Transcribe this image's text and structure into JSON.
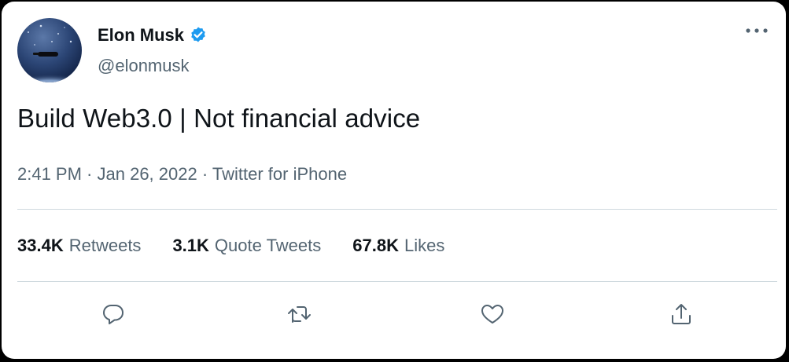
{
  "author": {
    "name": "Elon Musk",
    "handle": "@elonmusk",
    "verified": true,
    "verified_icon": "verified-badge-icon",
    "avatar_icon": "avatar-image"
  },
  "tweet": {
    "text": "Build Web3.0 | Not financial advice"
  },
  "meta": {
    "time": "2:41 PM",
    "separator1": " · ",
    "date": "Jan 26, 2022",
    "separator2": " · ",
    "source": "Twitter for iPhone"
  },
  "stats": [
    {
      "count": "33.4K",
      "label": "Retweets"
    },
    {
      "count": "3.1K",
      "label": "Quote Tweets"
    },
    {
      "count": "67.8K",
      "label": "Likes"
    }
  ],
  "actions": [
    {
      "icon": "reply-icon"
    },
    {
      "icon": "retweet-icon"
    },
    {
      "icon": "like-icon"
    },
    {
      "icon": "share-icon"
    }
  ],
  "more_icon": "more-options-icon",
  "colors": {
    "text_primary": "#0f1419",
    "text_secondary": "#536471",
    "verified_blue": "#1d9bf0",
    "divider": "#cfd9de"
  }
}
